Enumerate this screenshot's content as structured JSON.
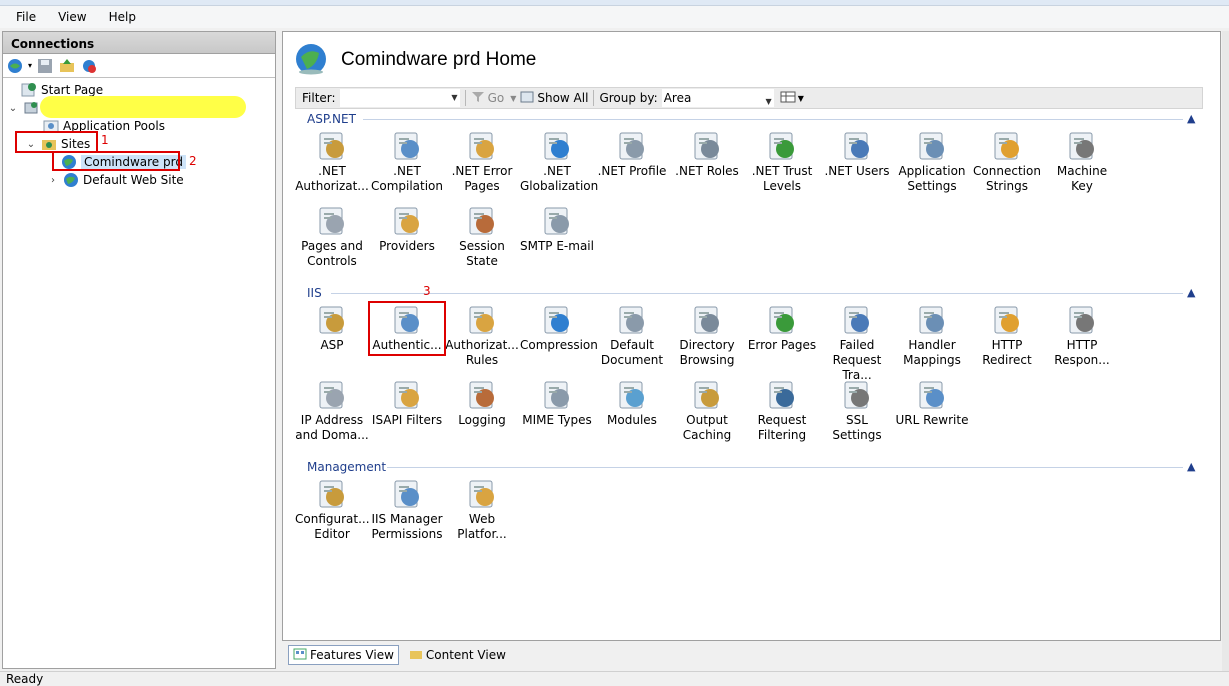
{
  "menu": [
    "File",
    "View",
    "Help"
  ],
  "connections": {
    "title": "Connections",
    "tree": {
      "start_page": "Start Page",
      "app_pools": "Application Pools",
      "sites": "Sites",
      "site_selected": "Comindware prd",
      "site_default": "Default Web Site"
    }
  },
  "annotations": [
    "1",
    "2",
    "3"
  ],
  "main": {
    "title": "Comindware prd Home",
    "filter_label": "Filter:",
    "go_label": "Go",
    "show_all_label": "Show All",
    "group_by_label": "Group by:",
    "group_by_value": "Area",
    "sections": {
      "aspnet": "ASP.NET",
      "iis": "IIS",
      "management": "Management"
    },
    "aspnet_features": [
      [
        ".NET",
        "Authorizat..."
      ],
      [
        ".NET",
        "Compilation"
      ],
      [
        ".NET Error",
        "Pages"
      ],
      [
        ".NET",
        "Globalization"
      ],
      [
        ".NET Profile",
        ""
      ],
      [
        ".NET Roles",
        ""
      ],
      [
        ".NET Trust",
        "Levels"
      ],
      [
        ".NET Users",
        ""
      ],
      [
        "Application",
        "Settings"
      ],
      [
        "Connection",
        "Strings"
      ],
      [
        "Machine Key",
        ""
      ],
      [
        "Pages and",
        "Controls"
      ],
      [
        "Providers",
        ""
      ],
      [
        "Session State",
        ""
      ],
      [
        "SMTP E-mail",
        ""
      ]
    ],
    "iis_features": [
      [
        "ASP",
        ""
      ],
      [
        "Authentic...",
        ""
      ],
      [
        "Authorizat...",
        "Rules"
      ],
      [
        "Compression",
        ""
      ],
      [
        "Default",
        "Document"
      ],
      [
        "Directory",
        "Browsing"
      ],
      [
        "Error Pages",
        ""
      ],
      [
        "Failed",
        "Request Tra..."
      ],
      [
        "Handler",
        "Mappings"
      ],
      [
        "HTTP",
        "Redirect"
      ],
      [
        "HTTP",
        "Respon..."
      ],
      [
        "IP Address",
        "and Doma..."
      ],
      [
        "ISAPI Filters",
        ""
      ],
      [
        "Logging",
        ""
      ],
      [
        "MIME Types",
        ""
      ],
      [
        "Modules",
        ""
      ],
      [
        "Output",
        "Caching"
      ],
      [
        "Request",
        "Filtering"
      ],
      [
        "SSL Settings",
        ""
      ],
      [
        "URL Rewrite",
        ""
      ]
    ],
    "management_features": [
      [
        "Configurat...",
        "Editor"
      ],
      [
        "IIS Manager",
        "Permissions"
      ],
      [
        "Web",
        "Platfor..."
      ]
    ]
  },
  "tabs": {
    "features_view": "Features View",
    "content_view": "Content View"
  },
  "status": "Ready"
}
